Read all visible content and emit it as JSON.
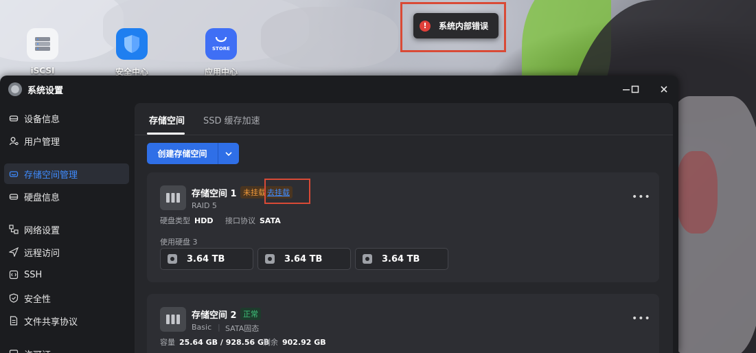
{
  "desktop": {
    "icons": [
      {
        "label": "iSCSI",
        "icon": "iscsi-server-icon"
      },
      {
        "label": "安全中心",
        "icon": "shield-icon"
      },
      {
        "label": "应用中心",
        "icon": "store-bag-icon",
        "tile_text": "STORE"
      }
    ]
  },
  "toast": {
    "message": "系统内部错误",
    "icon": "error-icon",
    "color": "#e0403a"
  },
  "window": {
    "title": "系统设置",
    "controls": {
      "minimize": "minimize-icon",
      "maximize": "maximize-icon",
      "close": "close-icon"
    }
  },
  "sidebar": {
    "items": [
      {
        "label": "设备信息",
        "icon": "device-icon"
      },
      {
        "label": "用户管理",
        "icon": "user-icon"
      },
      {
        "label": "存储空间管理",
        "icon": "storage-icon",
        "active": true
      },
      {
        "label": "硬盘信息",
        "icon": "disk-icon"
      },
      {
        "label": "网络设置",
        "icon": "network-icon"
      },
      {
        "label": "远程访问",
        "icon": "send-icon"
      },
      {
        "label": "SSH",
        "icon": "ssh-icon"
      },
      {
        "label": "安全性",
        "icon": "shield-check-icon"
      },
      {
        "label": "文件共享协议",
        "icon": "file-icon"
      },
      {
        "label": "许可证",
        "icon": "license-icon"
      }
    ]
  },
  "main": {
    "tabs": [
      {
        "label": "存储空间",
        "active": true
      },
      {
        "label": "SSD 缓存加速",
        "active": false
      }
    ],
    "create_button": "创建存储空间",
    "pools": [
      {
        "name": "存储空间 1",
        "status": "未挂载",
        "action_link": "去挂载",
        "raid": "RAID 5",
        "disk_type_label": "硬盘类型",
        "disk_type": "HDD",
        "interface_label": "接口协议",
        "interface": "SATA",
        "used_disks_label": "使用硬盘 3",
        "disks": [
          "3.64 TB",
          "3.64 TB",
          "3.64 TB"
        ]
      },
      {
        "name": "存储空间 2",
        "status": "正常",
        "type": "Basic",
        "media": "SATA固态",
        "capacity_label": "容量",
        "capacity": "25.64 GB / 928.56 GB",
        "remaining_label": "剩余",
        "remaining": "902.92 GB"
      }
    ]
  },
  "colors": {
    "accent": "#2f6fe7",
    "warning": "#f19a3b",
    "success": "#3fc07a",
    "highlight": "#d94a36"
  }
}
